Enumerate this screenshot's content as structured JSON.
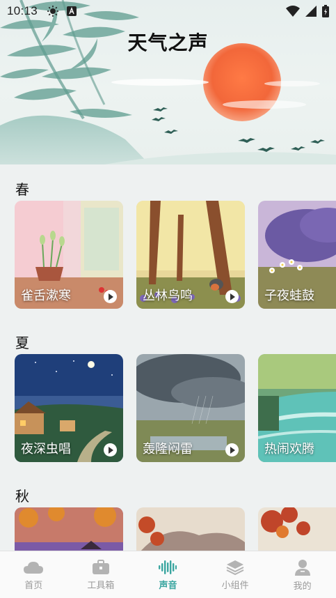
{
  "status_bar": {
    "time": "10:13",
    "icons_left": [
      "brightness-icon",
      "app-notification-icon"
    ],
    "icons_right": [
      "wifi-icon",
      "signal-icon",
      "battery-charging-icon"
    ]
  },
  "hero": {
    "title": "天气之声"
  },
  "sections": [
    {
      "title": "春",
      "cards": [
        {
          "label": "雀舌漱寒"
        },
        {
          "label": "丛林鸟鸣"
        },
        {
          "label": "子夜蛙鼓"
        }
      ]
    },
    {
      "title": "夏",
      "cards": [
        {
          "label": "夜深虫唱"
        },
        {
          "label": "轰隆闷雷"
        },
        {
          "label": "热闹欢腾"
        }
      ]
    },
    {
      "title": "秋",
      "cards": [
        {
          "label": ""
        },
        {
          "label": ""
        },
        {
          "label": ""
        }
      ]
    }
  ],
  "bottom_nav": {
    "items": [
      {
        "label": "首页",
        "icon": "cloud-icon",
        "active": false
      },
      {
        "label": "工具箱",
        "icon": "toolbox-icon",
        "active": false
      },
      {
        "label": "声音",
        "icon": "soundwave-icon",
        "active": true
      },
      {
        "label": "小组件",
        "icon": "layers-icon",
        "active": false
      },
      {
        "label": "我的",
        "icon": "profile-icon",
        "active": false
      }
    ]
  },
  "colors": {
    "accent": "#3aa6a0",
    "nav_inactive": "#9a9a9a",
    "sun": "#f2673a",
    "background": "#eef1f1"
  }
}
